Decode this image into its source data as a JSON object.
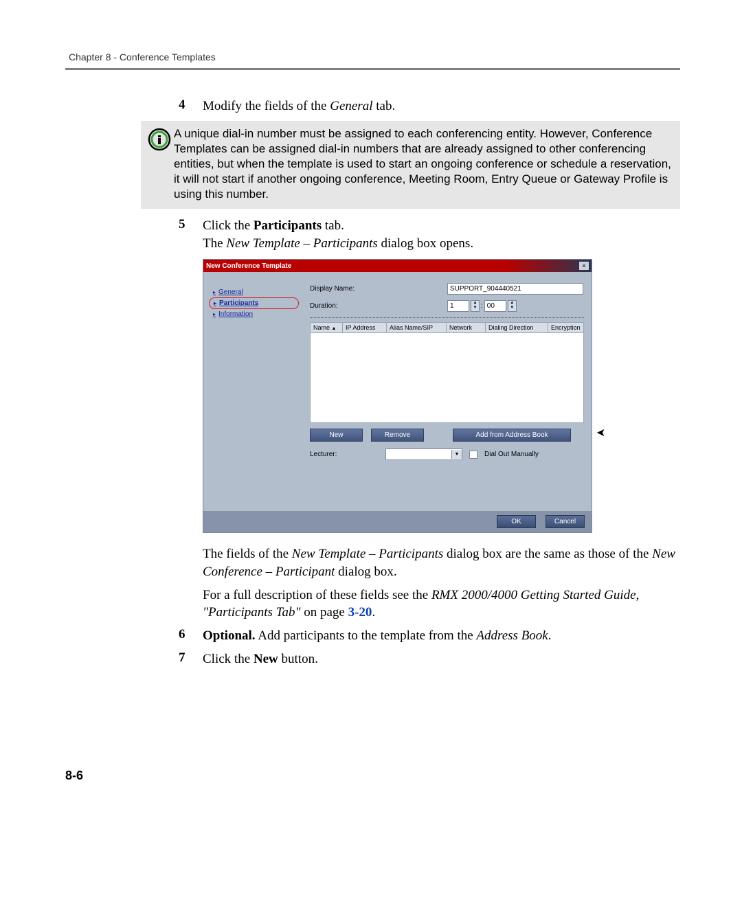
{
  "header": {
    "running": "Chapter 8 - Conference Templates"
  },
  "steps": {
    "s4": {
      "num": "4",
      "pre": "Modify the fields of the ",
      "italic": "General",
      "post": " tab."
    },
    "s5": {
      "num": "5",
      "line1_pre": "Click the ",
      "line1_bold": "Participants",
      "line1_post": " tab.",
      "line2_pre": "The ",
      "line2_italic": "New Template – Participants",
      "line2_post": " dialog box opens."
    },
    "s6": {
      "num": "6",
      "bold": "Optional.",
      "mid": " Add participants to the template from the ",
      "italic": "Address Book",
      "post": "."
    },
    "s7": {
      "num": "7",
      "pre": "Click the ",
      "bold": "New",
      "post": " button."
    }
  },
  "callout": {
    "text": "A unique dial-in number must be assigned to each conferencing entity. However, Conference Templates can be assigned dial-in numbers that are already assigned to other conferencing entities, but when the template is used to start an ongoing conference or schedule a reservation, it will not start if another ongoing conference, Meeting Room, Entry Queue or Gateway Profile is using this number."
  },
  "after_dialog": {
    "p1_pre": "The fields of the ",
    "p1_i1": "New Template – Participants",
    "p1_mid": " dialog box are the same as those of the ",
    "p1_i2": "New Conference – Participant",
    "p1_post": " dialog box.",
    "p2_pre": "For a full description of these fields see the ",
    "p2_i": "RMX 2000/4000 Getting Started Guide, \"Participants Tab\"",
    "p2_mid": " on page ",
    "p2_link": "3-20",
    "p2_post": "."
  },
  "dialog": {
    "title": "New Conference Template",
    "nav": {
      "general": "General",
      "participants": "Participants",
      "information": "Information"
    },
    "labels": {
      "display_name": "Display Name:",
      "duration": "Duration:",
      "lecturer": "Lecturer:",
      "dial_out": "Dial Out Manually"
    },
    "display_name_value": "SUPPORT_904440521",
    "duration_h": "1",
    "duration_sep": ":",
    "duration_m": "00",
    "cols": {
      "name": "Name",
      "ip": "IP Address",
      "alias": "Alias Name/SIP",
      "network": "Network",
      "dial": "Dialing Direction",
      "enc": "Encryption"
    },
    "buttons": {
      "new": "New",
      "remove": "Remove",
      "address_book": "Add from Address Book",
      "ok": "OK",
      "cancel": "Cancel"
    },
    "close": "×"
  },
  "page_number": "8-6"
}
